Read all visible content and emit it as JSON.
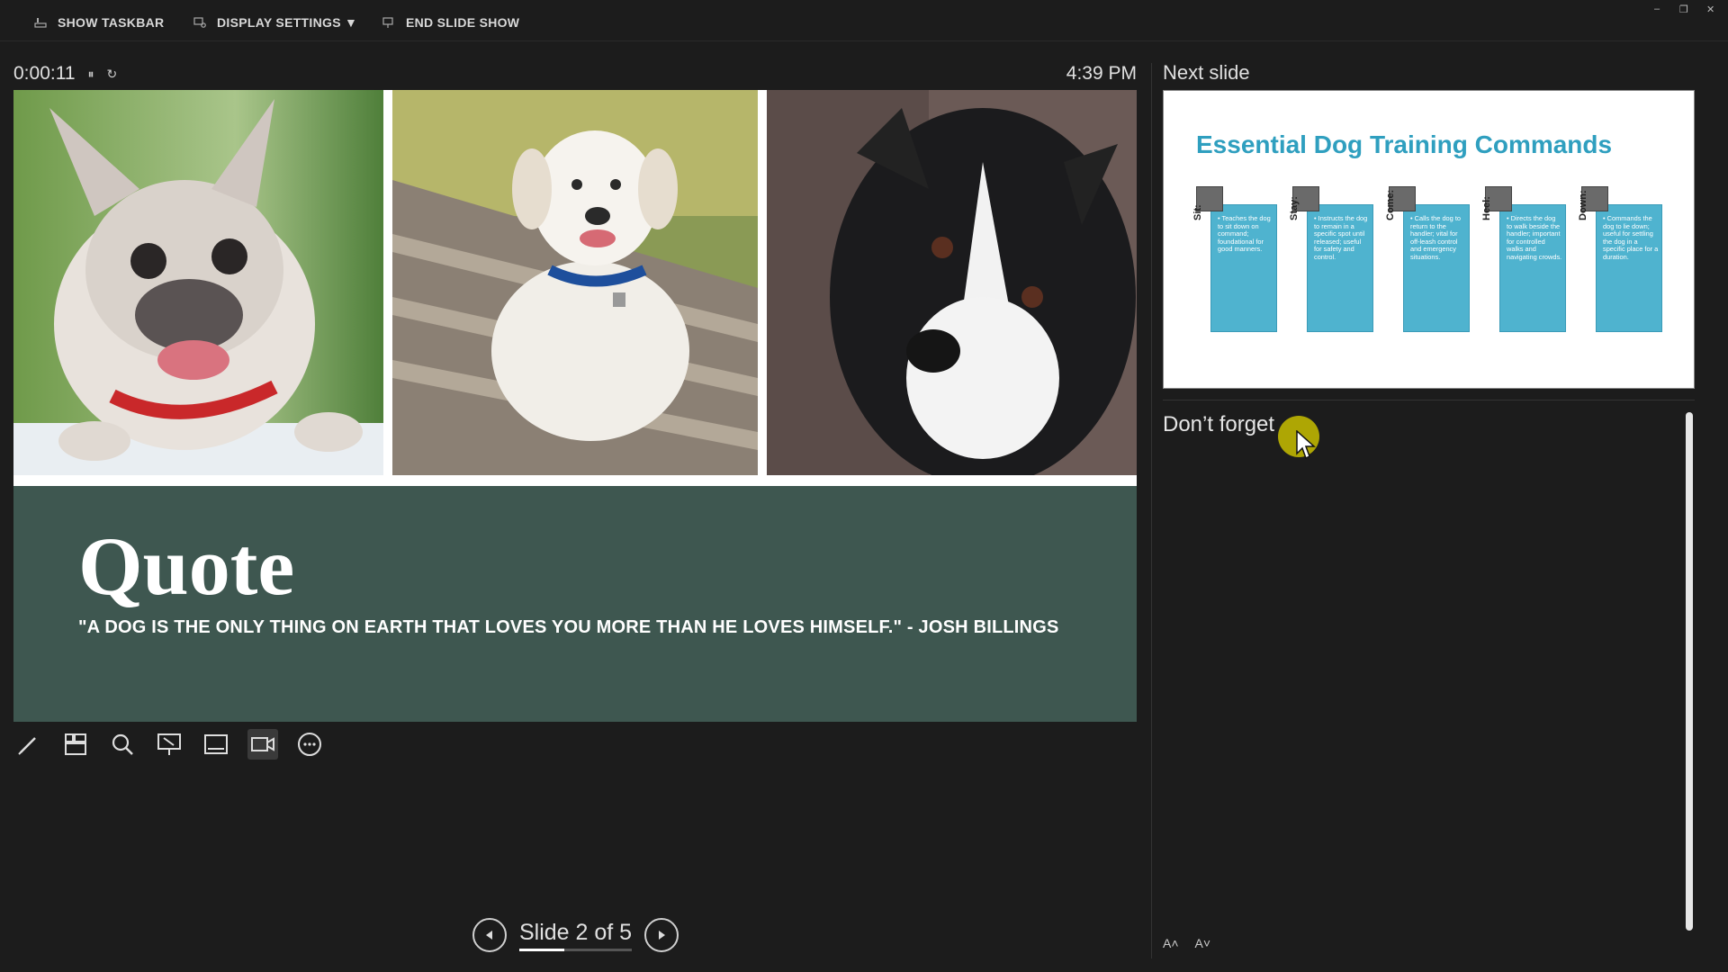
{
  "toolbar": {
    "show_taskbar": "SHOW TASKBAR",
    "display_settings": "DISPLAY SETTINGS ▼",
    "end_slide_show": "END SLIDE SHOW"
  },
  "window": {
    "minimize": "–",
    "restore": "❐",
    "close": "✕"
  },
  "timer": {
    "elapsed": "0:00:11",
    "pause_icon": "pause-icon",
    "reset_icon": "reset-icon"
  },
  "clock": "4:39 PM",
  "slide": {
    "title": "Quote",
    "quote": "\"A DOG IS THE ONLY THING ON EARTH THAT LOVES YOU MORE THAN HE LOVES HIMSELF.\" - JOSH BILLINGS",
    "band_color": "#3e5750",
    "photos": [
      "french-bulldog-photo",
      "labrador-on-bench-photo",
      "border-collie-photo"
    ]
  },
  "tools": [
    "pen-icon",
    "all-slides-icon",
    "zoom-icon",
    "pointer-icon",
    "subtitles-icon",
    "camera-icon",
    "more-options-icon"
  ],
  "navigation": {
    "label": "Slide 2 of 5",
    "progress": 0.4
  },
  "next_slide": {
    "label": "Next slide",
    "title": "Essential Dog Training Commands",
    "accent": "#2f9fbf",
    "commands": [
      {
        "name": "Sit:",
        "desc": "• Teaches the dog to sit down on command; foundational for good manners."
      },
      {
        "name": "Stay:",
        "desc": "• Instructs the dog to remain in a specific spot until released; useful for safety and control."
      },
      {
        "name": "Come:",
        "desc": "• Calls the dog to return to the handler; vital for off-leash control and emergency situations."
      },
      {
        "name": "Heel:",
        "desc": "• Directs the dog to walk beside the handler; important for controlled walks and navigating crowds."
      },
      {
        "name": "Down:",
        "desc": "• Commands the dog to lie down; useful for settling the dog in a specific place for a duration."
      }
    ]
  },
  "notes": {
    "text": "Don’t forget"
  },
  "font_controls": {
    "increase": "A˄",
    "decrease": "A˅"
  }
}
